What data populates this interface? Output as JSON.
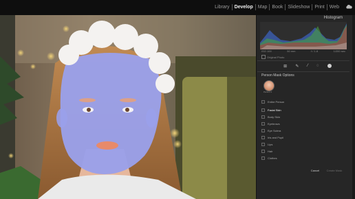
{
  "modules": {
    "items": [
      {
        "label": "Library"
      },
      {
        "label": "Develop",
        "active": true
      },
      {
        "label": "Map"
      },
      {
        "label": "Book"
      },
      {
        "label": "Slideshow"
      },
      {
        "label": "Print"
      },
      {
        "label": "Web"
      }
    ],
    "cloud_icon": "cloud-icon"
  },
  "histogram": {
    "title": "Histogram",
    "labels": [
      "ISO 100",
      "50 mm",
      "f / 1.8",
      "1/200 sec"
    ],
    "original_photo_label": "Original Photo"
  },
  "tools": [
    "crop-icon",
    "healing-icon",
    "brush-icon",
    "redeye-icon",
    "mask-icon"
  ],
  "person_mask": {
    "title": "Person Mask Options",
    "person_label": "Person 1",
    "options": [
      {
        "label": "Entire Person",
        "highlight": false
      },
      {
        "label": "Facial Skin",
        "highlight": true
      },
      {
        "label": "Body Skin",
        "highlight": false
      },
      {
        "label": "Eyebrows",
        "highlight": false
      },
      {
        "label": "Eye Sclera",
        "highlight": false
      },
      {
        "label": "Iris and Pupil",
        "highlight": false
      },
      {
        "label": "Lips",
        "highlight": false
      },
      {
        "label": "Hair",
        "highlight": false
      },
      {
        "label": "Clothes",
        "highlight": false
      }
    ],
    "cancel_label": "Cancel",
    "create_label": "Create Mask"
  },
  "colors": {
    "mask_overlay": "#9aa0ea",
    "panel_bg": "#262626",
    "topbar_bg": "#0e0e0e"
  }
}
